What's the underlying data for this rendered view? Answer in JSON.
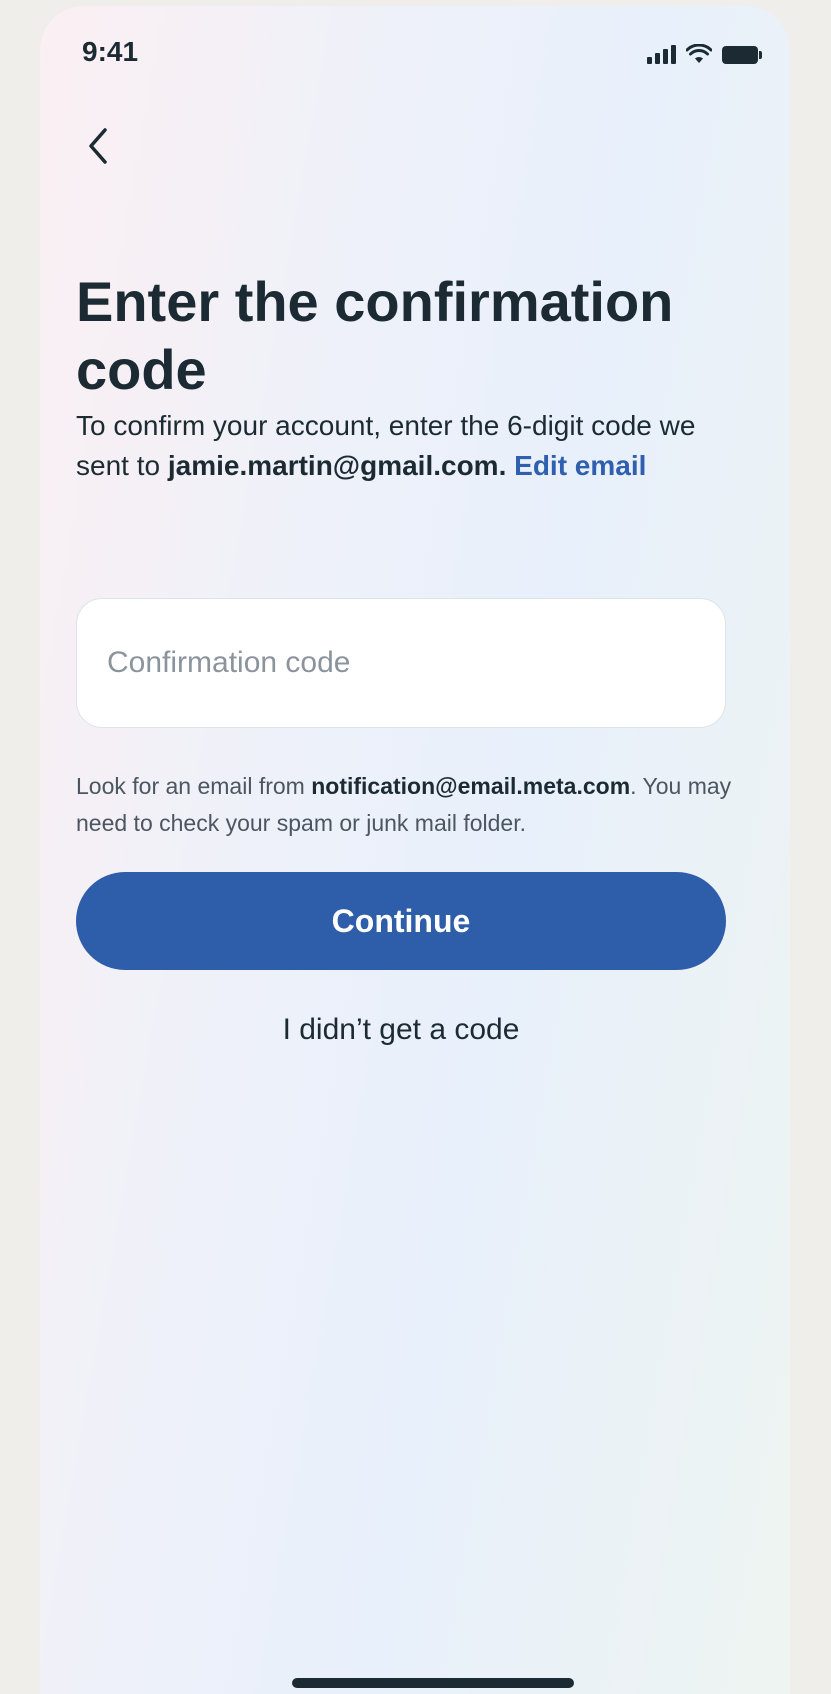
{
  "status_bar": {
    "time": "9:41",
    "icons": [
      "signal-icon",
      "wifi-icon",
      "battery-icon"
    ]
  },
  "header": {
    "back_icon": "chevron-left-icon"
  },
  "main": {
    "title": "Enter the confirmation code",
    "description": {
      "prefix": "To confirm your account, enter the 6-digit code we sent to ",
      "email": "jamie.martin@gmail.com.",
      "edit_link": "Edit email"
    },
    "code_input": {
      "placeholder": "Confirmation code",
      "value": ""
    },
    "hint": {
      "prefix": "Look for an email from ",
      "sender": "notification@email.meta.com",
      "suffix": ". You may need to check your spam or junk mail folder."
    },
    "continue_label": "Continue",
    "no_code_label": "I didn’t get a code"
  },
  "colors": {
    "accent": "#2e5eaa",
    "link": "#2f5fae",
    "text": "#1c2b33"
  }
}
